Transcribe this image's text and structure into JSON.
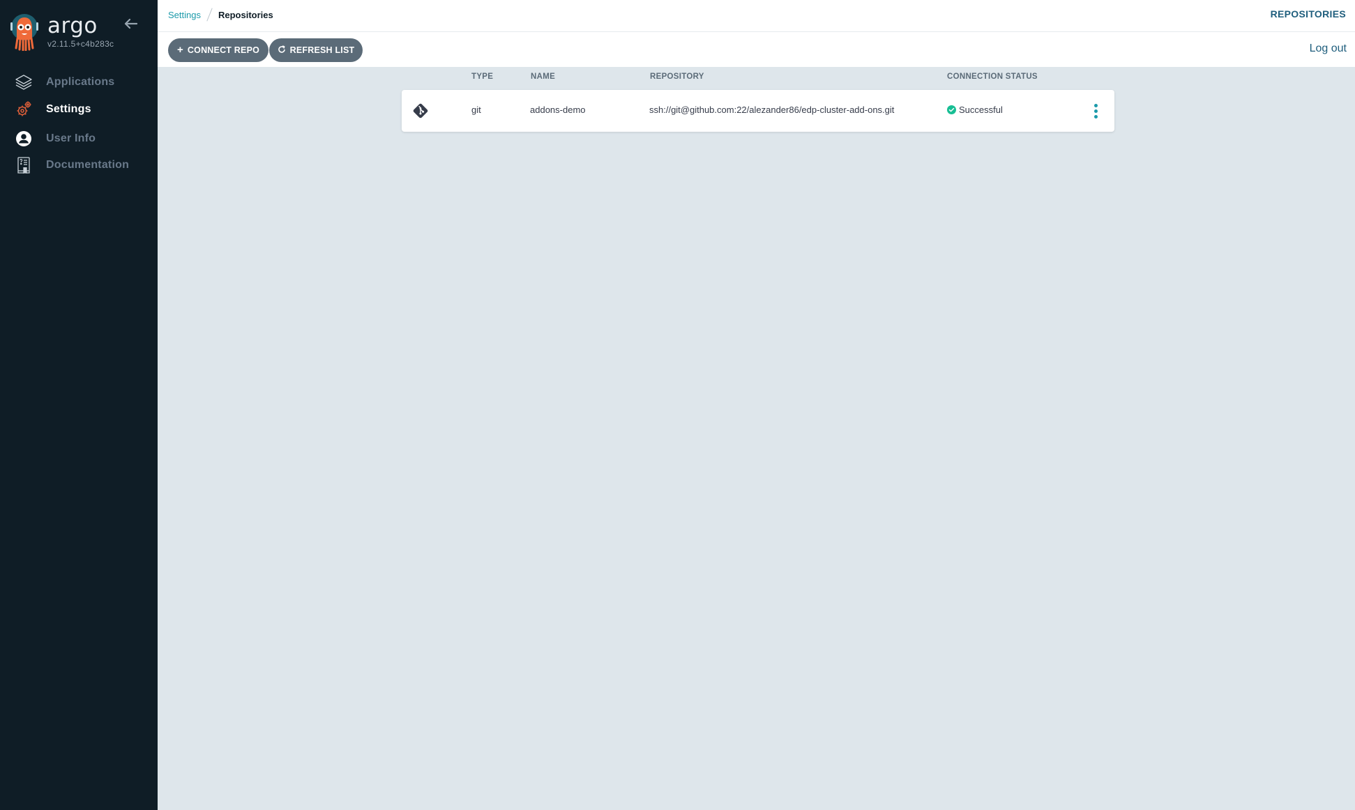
{
  "sidebar": {
    "brand": "argo",
    "version": "v2.11.5+c4b283c",
    "collapse_icon": "arrow-left-icon",
    "items": [
      {
        "label": "Applications",
        "icon": "layers-icon",
        "active": false
      },
      {
        "label": "Settings",
        "icon": "gears-icon",
        "active": true
      },
      {
        "label": "User Info",
        "icon": "user-circle-icon",
        "active": false
      },
      {
        "label": "Documentation",
        "icon": "book-icon",
        "active": false
      }
    ]
  },
  "topbar": {
    "breadcrumbs": [
      {
        "label": "Settings",
        "link": true
      },
      {
        "label": "Repositories",
        "link": false
      }
    ],
    "page_title": "REPOSITORIES",
    "logout_label": "Log out",
    "buttons": {
      "connect": {
        "label": "CONNECT REPO",
        "icon": "plus-icon"
      },
      "refresh": {
        "label": "REFRESH LIST",
        "icon": "refresh-icon"
      }
    }
  },
  "table": {
    "columns": [
      "TYPE",
      "NAME",
      "REPOSITORY",
      "CONNECTION STATUS"
    ],
    "rows": [
      {
        "icon": "git-icon",
        "type": "git",
        "name": "addons-demo",
        "repository": "ssh://git@github.com:22/alezander86/edp-cluster-add-ons.git",
        "status": "Successful",
        "status_icon": "check-circle-icon"
      }
    ]
  },
  "colors": {
    "sidebar_bg": "#0f1d26",
    "accent": "#1b9aaa",
    "active_icon": "#e0603a",
    "success": "#18be94",
    "button_bg": "#5b6b78",
    "content_bg": "#dee6eb"
  }
}
